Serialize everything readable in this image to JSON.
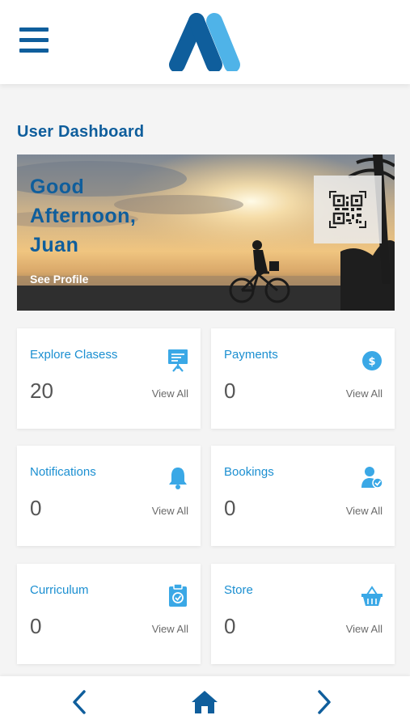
{
  "header": {
    "menu_icon": "hamburger-menu-icon",
    "logo_icon": "brand-logo",
    "brand_color": "#0f5e9c",
    "brand_light": "#4fb3e8"
  },
  "page": {
    "title": "User Dashboard"
  },
  "hero": {
    "greeting_line1": "Good",
    "greeting_line2": "Afternoon,",
    "greeting_line3": "Juan",
    "profile_link": "See Profile",
    "qr_icon": "qr-code-icon"
  },
  "cards": [
    {
      "title": "Explore Clasess",
      "count": "20",
      "link": "View All",
      "icon": "presentation-board-icon"
    },
    {
      "title": "Payments",
      "count": "0",
      "link": "View All",
      "icon": "dollar-coin-icon"
    },
    {
      "title": "Notifications",
      "count": "0",
      "link": "View All",
      "icon": "bell-icon"
    },
    {
      "title": "Bookings",
      "count": "0",
      "link": "View All",
      "icon": "user-check-icon"
    },
    {
      "title": "Curriculum",
      "count": "0",
      "link": "View All",
      "icon": "clipboard-check-icon"
    },
    {
      "title": "Store",
      "count": "0",
      "link": "View All",
      "icon": "shopping-basket-icon"
    }
  ],
  "bottom_nav": {
    "back_icon": "chevron-left-icon",
    "home_icon": "home-icon",
    "forward_icon": "chevron-right-icon"
  },
  "colors": {
    "accent": "#1b8fd1",
    "icon": "#3aa8e6"
  }
}
